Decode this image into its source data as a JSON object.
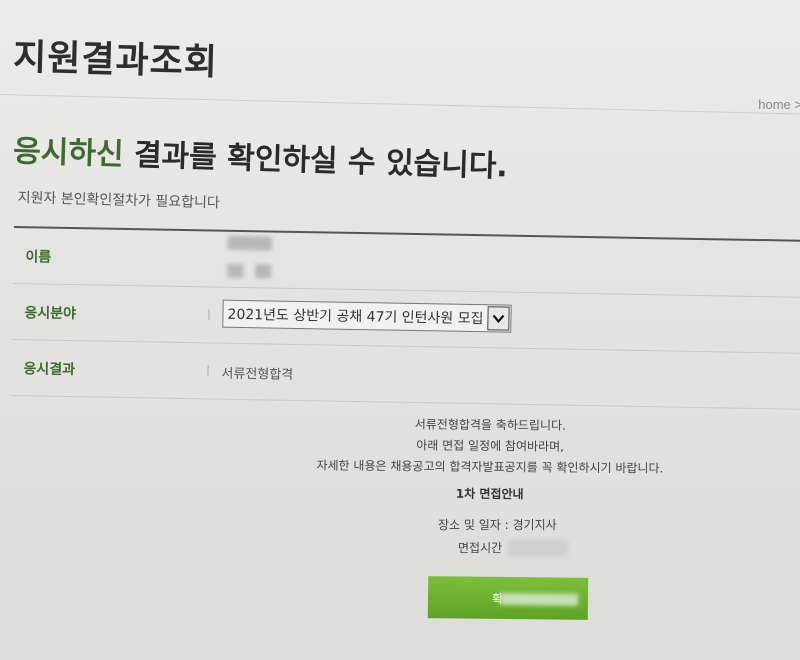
{
  "page": {
    "title": "지원결과조회",
    "breadcrumb": "home >"
  },
  "headline": {
    "accent": "응시하신",
    "rest": " 결과를 확인하실 수 있습니다."
  },
  "subtext": "지원자 본인확인절차가 필요합니다",
  "form": {
    "name_label": "이름",
    "field_label": "응시분야",
    "field_selected": "2021년도 상반기 공채 47기 인턴사원 모집",
    "result_label": "응시결과",
    "result_value": "서류전형합격"
  },
  "message": {
    "line1": "서류전형합격을 축하드립니다.",
    "line2": "아래 면접 일정에 참여바라며,",
    "line3": "자세한 내용은 채용공고의 합격자발표공지를 꼭 확인하시기 바랍니다.",
    "notice_title": "1차 면접안내",
    "place_date": "장소 및 일자 : 경기지사",
    "time_label": "면접시간"
  },
  "button": {
    "label": "확"
  },
  "colors": {
    "accent_green": "#3d6b2f",
    "button_green": "#6cb031"
  }
}
